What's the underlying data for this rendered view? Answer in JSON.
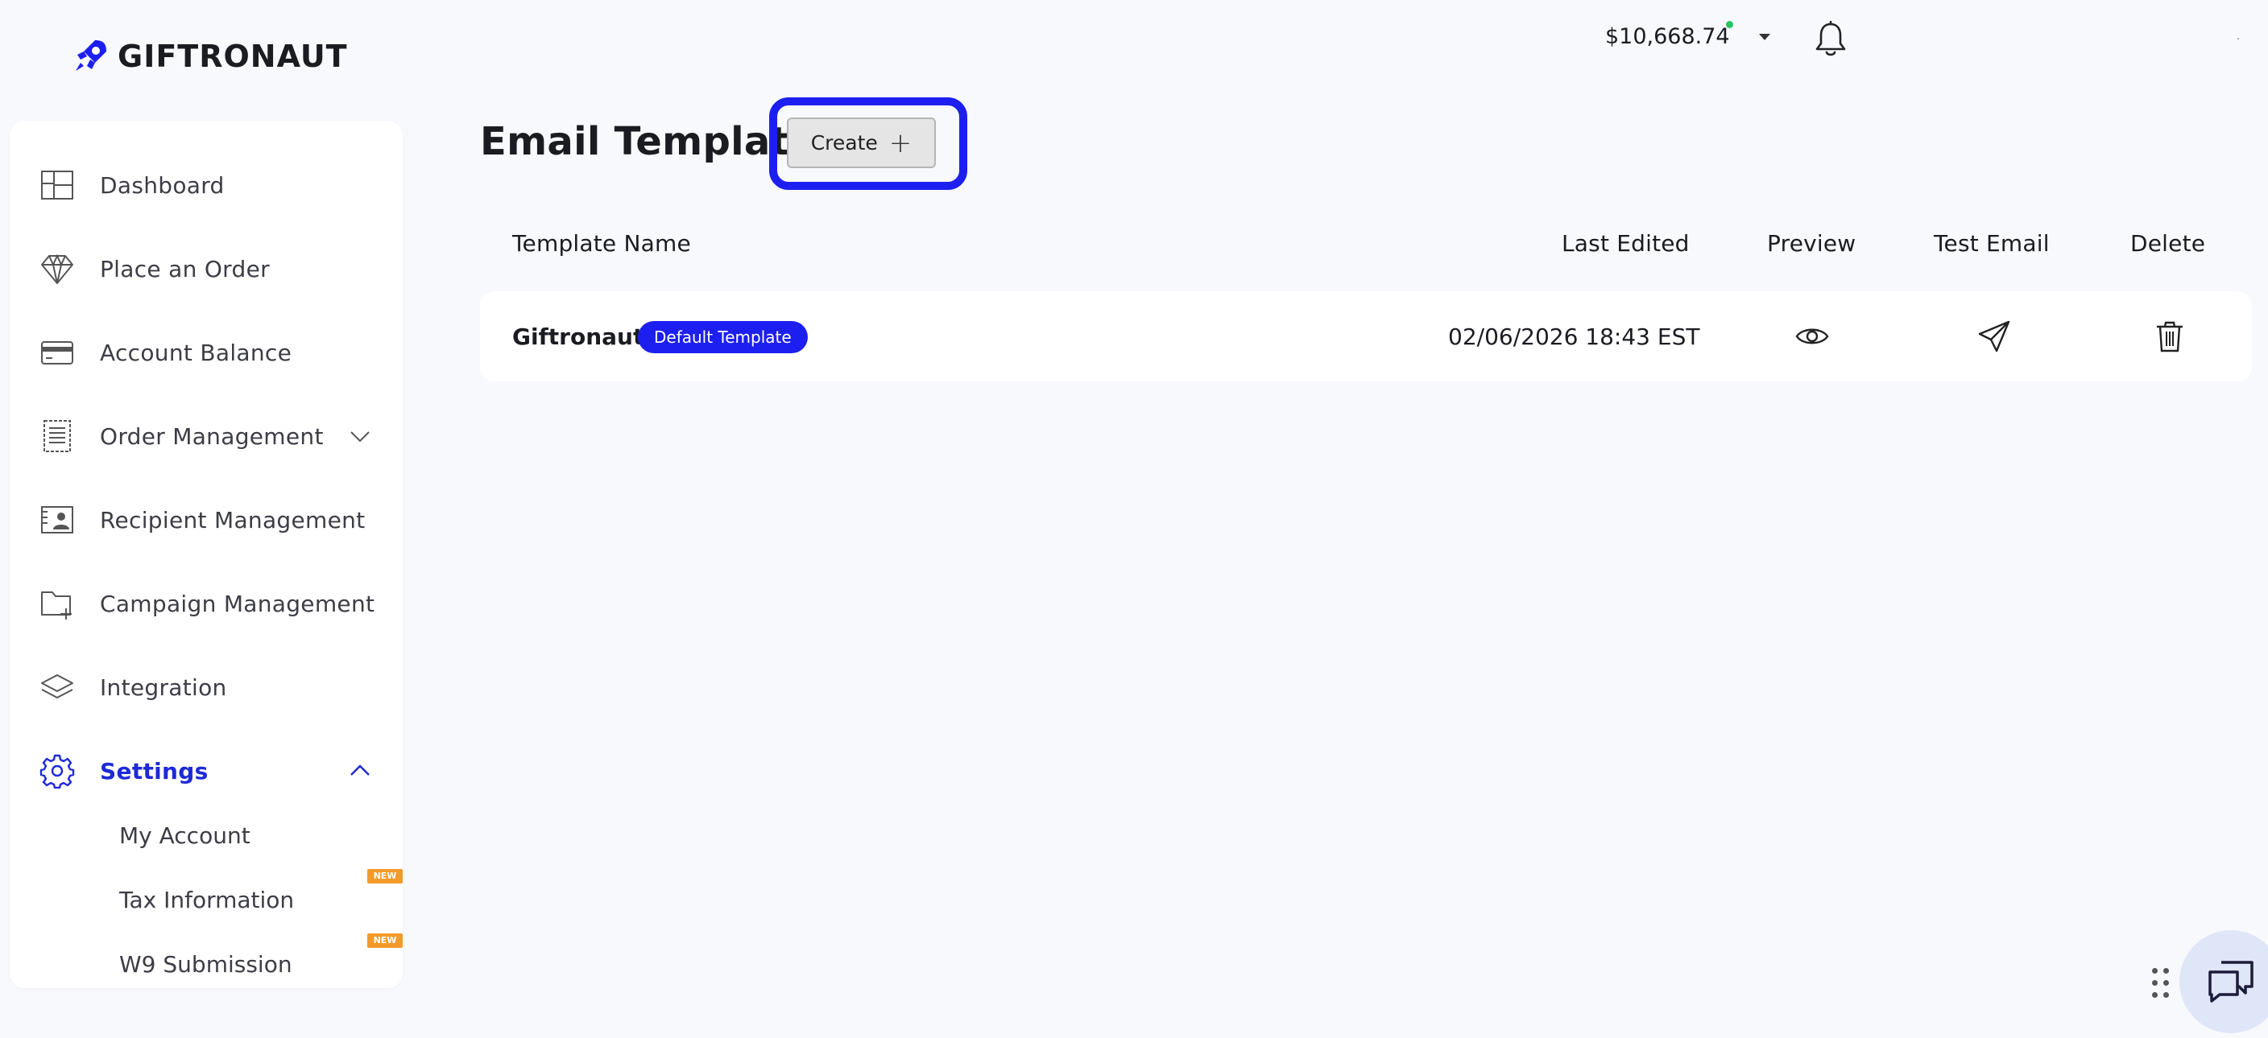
{
  "brand": {
    "name": "GIFTRONAUT",
    "accent": "#1d1ff0"
  },
  "header": {
    "balance": "$10,668.74",
    "balance_status_color": "#22c55e",
    "icons": [
      "rocket-logo-icon",
      "caret-down-icon",
      "bell-icon"
    ]
  },
  "sidebar": {
    "items": [
      {
        "label": "Dashboard",
        "icon": "dashboard-icon"
      },
      {
        "label": "Place an Order",
        "icon": "diamond-icon"
      },
      {
        "label": "Account Balance",
        "icon": "credit-card-icon"
      },
      {
        "label": "Order Management",
        "icon": "receipt-icon",
        "expanded": false
      },
      {
        "label": "Recipient Management",
        "icon": "contact-card-icon"
      },
      {
        "label": "Campaign Management",
        "icon": "folder-plus-icon"
      },
      {
        "label": "Integration",
        "icon": "layers-icon"
      },
      {
        "label": "Settings",
        "icon": "gear-icon",
        "expanded": true,
        "active": true
      }
    ],
    "settings_subitems": [
      {
        "label": "My Account",
        "badge": ""
      },
      {
        "label": "Tax Information",
        "badge": "NEW"
      },
      {
        "label": "W9 Submission",
        "badge": "NEW"
      }
    ]
  },
  "main": {
    "title": "Email Template",
    "create_label": "Create",
    "table": {
      "headers": [
        "Template Name",
        "Last Edited",
        "Preview",
        "Test Email",
        "Delete"
      ],
      "rows": [
        {
          "name": "Giftronaut",
          "badge": "Default Template",
          "last_edited": "02/06/2026 18:43 EST",
          "preview_icon": "eye-icon",
          "test_email_icon": "send-icon",
          "delete_icon": "trash-icon"
        }
      ]
    }
  },
  "widgets": {
    "chat_icon": "chat-icon",
    "drag_icon": "drag-handle-icon"
  }
}
